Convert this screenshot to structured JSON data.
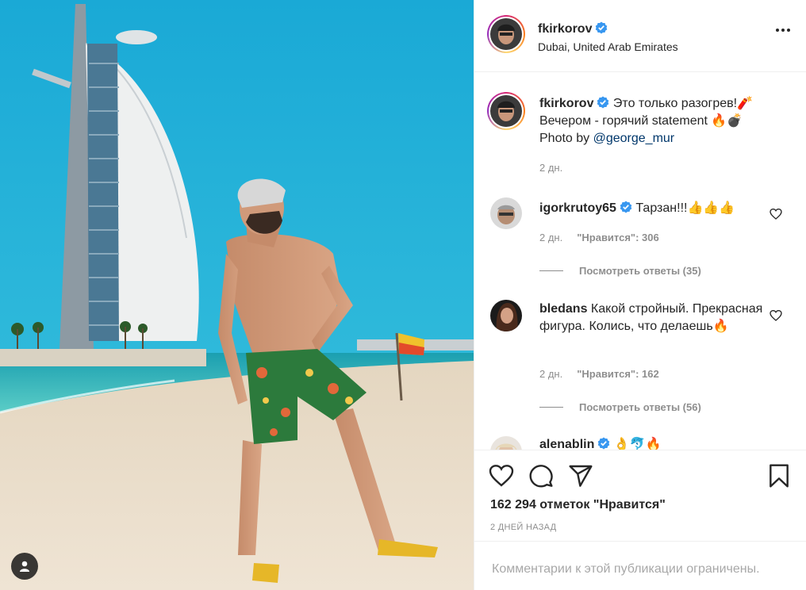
{
  "post": {
    "author": "fkirkorov",
    "location": "Dubai, United Arab Emirates",
    "photo_alt": "Man in floral swim shorts on the beach in front of Burj Al Arab"
  },
  "caption": {
    "username": "fkirkorov",
    "line1": "Это только разогрев!🧨",
    "line2": "Вечером - горячий statement 🔥💣",
    "line3_prefix": "Photo by ",
    "mention": "@george_mur",
    "time": "2 дн."
  },
  "comments": [
    {
      "username": "igorkrutoy65",
      "text": "Тарзан!!!👍👍👍",
      "time": "2 дн.",
      "likes": "\"Нравится\": 306",
      "replies": "Посмотреть ответы (35)"
    },
    {
      "username": "bledans",
      "text": "Какой стройный. Прекрасная фигура. Колись, что делаешь🔥",
      "time": "2 дн.",
      "likes": "\"Нравится\": 162",
      "replies": "Посмотреть ответы (56)"
    },
    {
      "username": "alenablin",
      "text": "👌🐬🔥"
    }
  ],
  "actions": {
    "likes_count": "162 294 отметок \"Нравится\"",
    "post_date": "2 ДНЕЙ НАЗАД",
    "like_icon": "heart-icon",
    "comment_icon": "comment-icon",
    "share_icon": "paper-plane-icon",
    "save_icon": "bookmark-icon"
  },
  "footer": {
    "restricted_text": "Комментарии к этой публикации ограничены."
  },
  "colors": {
    "text": "#262626",
    "secondary": "#8e8e8e",
    "link": "#00376b",
    "verified": "#3897f0",
    "border": "#efefef"
  }
}
